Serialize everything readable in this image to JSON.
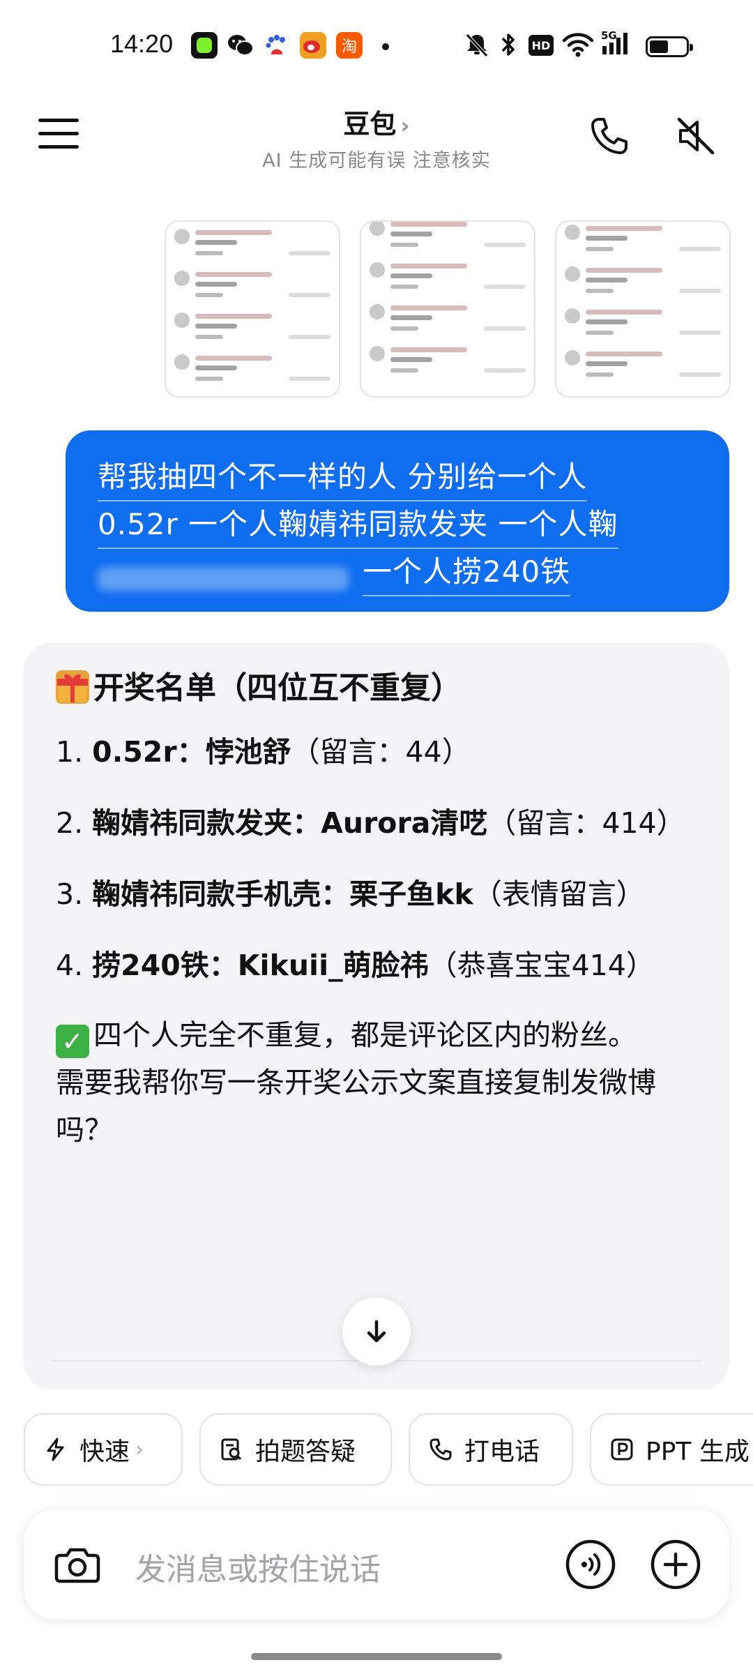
{
  "status_bar": {
    "time": "14:20",
    "apps": [
      "green-app-icon",
      "wechat-icon",
      "baidu-icon",
      "weibo-icon",
      "taobao-icon"
    ],
    "taobao_glyph": "淘",
    "right_icons": [
      "mute-icon",
      "bluetooth-icon",
      "hd-icon",
      "wifi-icon",
      "5g-signal-icon",
      "battery-icon"
    ],
    "hd_label": "HD",
    "net_label": "5G"
  },
  "header": {
    "title": "豆包",
    "title_chevron": "›",
    "subtitle": "AI 生成可能有误 注意核实"
  },
  "user_message": {
    "line1": "帮我抽四个不一样的人 分别给一个人",
    "line2": "0.52r 一个人鞠婧祎同款发夹  一个人鞠",
    "line3": "一个人捞240铁"
  },
  "ai_message": {
    "heading": "开奖名单（四位互不重复）",
    "items": [
      {
        "num": "1.",
        "prize": "0.52r：",
        "winner": "悖池舒",
        "note": "（留言：44）"
      },
      {
        "num": "2.",
        "prize": "鞠婧祎同款发夹：",
        "winner": "Aurora清呓",
        "note": "（留言：414）"
      },
      {
        "num": "3.",
        "prize": "鞠婧祎同款手机壳：",
        "winner": "栗子鱼kk",
        "note": "（表情留言）"
      },
      {
        "num": "4.",
        "prize": "捞240铁：",
        "winner": "Kikuii_萌脸祎",
        "note": "（恭喜宝宝414）"
      }
    ],
    "summary": "四个人完全不重复，都是评论区内的粉丝。",
    "question": "需要我帮你写一条开奖公示文案直接复制发微博吗？"
  },
  "chips": [
    {
      "label": "快速",
      "icon": "lightning-icon",
      "chevron": "›"
    },
    {
      "label": "拍题答疑",
      "icon": "scan-question-icon"
    },
    {
      "label": "打电话",
      "icon": "phone-icon"
    },
    {
      "label": "PPT 生成",
      "icon": "ppt-icon"
    }
  ],
  "input": {
    "placeholder": "发消息或按住说话"
  },
  "colors": {
    "accent": "#0f6df0",
    "card_bg": "#f4f4f6"
  }
}
